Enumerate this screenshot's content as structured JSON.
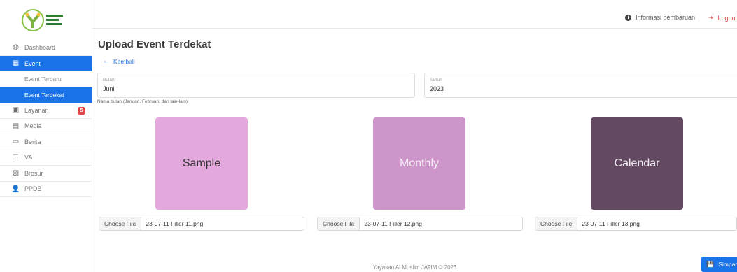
{
  "logo": {
    "alt": "SEKOLAH SANG PEMIMPIN"
  },
  "sidebar": {
    "items": [
      {
        "label": "Dashboard",
        "icon": "dashboard-icon"
      },
      {
        "label": "Event",
        "icon": "calendar-icon",
        "active": true
      },
      {
        "label": "Event Terbaru",
        "sub": true
      },
      {
        "label": "Event Terdekat",
        "sub": true,
        "active": true
      },
      {
        "label": "Layanan",
        "icon": "service-icon",
        "badge": "5"
      },
      {
        "label": "Media",
        "icon": "media-icon"
      },
      {
        "label": "Berita",
        "icon": "news-icon"
      },
      {
        "label": "VA",
        "icon": "va-icon"
      },
      {
        "label": "Brosur",
        "icon": "brochure-icon"
      },
      {
        "label": "PPDB",
        "icon": "ppdb-icon"
      }
    ]
  },
  "topbar": {
    "info_label": "Informasi pembaruan",
    "logout_label": "Logout"
  },
  "page": {
    "title": "Upload Event Terdekat",
    "back_label": "Kembali"
  },
  "form": {
    "bulan": {
      "label": "Bulan",
      "value": "Juni"
    },
    "tahun": {
      "label": "Tahun",
      "value": "2023"
    },
    "help": "Nama bulan (Januari, Februari, dan lain-lain)"
  },
  "images": [
    {
      "text": "Sample",
      "color": "#e3a9dd",
      "text_color": "#333333",
      "file_btn": "Choose File",
      "file_name": "23-07-11 Filler 11.png"
    },
    {
      "text": "Monthly",
      "color": "#cd95c9",
      "text_color": "#f4eef4",
      "file_btn": "Choose File",
      "file_name": "23-07-11 Filler 12.png"
    },
    {
      "text": "Calendar",
      "color": "#634a62",
      "text_color": "#f0eaf0",
      "file_btn": "Choose File",
      "file_name": "23-07-11 Filler 13.png"
    }
  ],
  "save_label": "Simpan",
  "footer": "Yayasan Al Muslim JATIM © 2023",
  "colors": {
    "accent": "#1a73e8",
    "danger": "#e0454b"
  }
}
